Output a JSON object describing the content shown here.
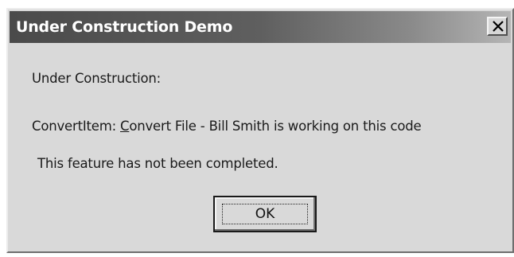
{
  "window": {
    "title": "Under Construction Demo",
    "close_icon": "close-icon"
  },
  "message": {
    "heading": "Under Construction:",
    "item_prefix": "ConvertItem: ",
    "item_accel_char": "C",
    "item_rest": "onvert File - Bill Smith is working on this code",
    "note": "This feature has not been completed."
  },
  "buttons": {
    "ok_label": "OK"
  }
}
